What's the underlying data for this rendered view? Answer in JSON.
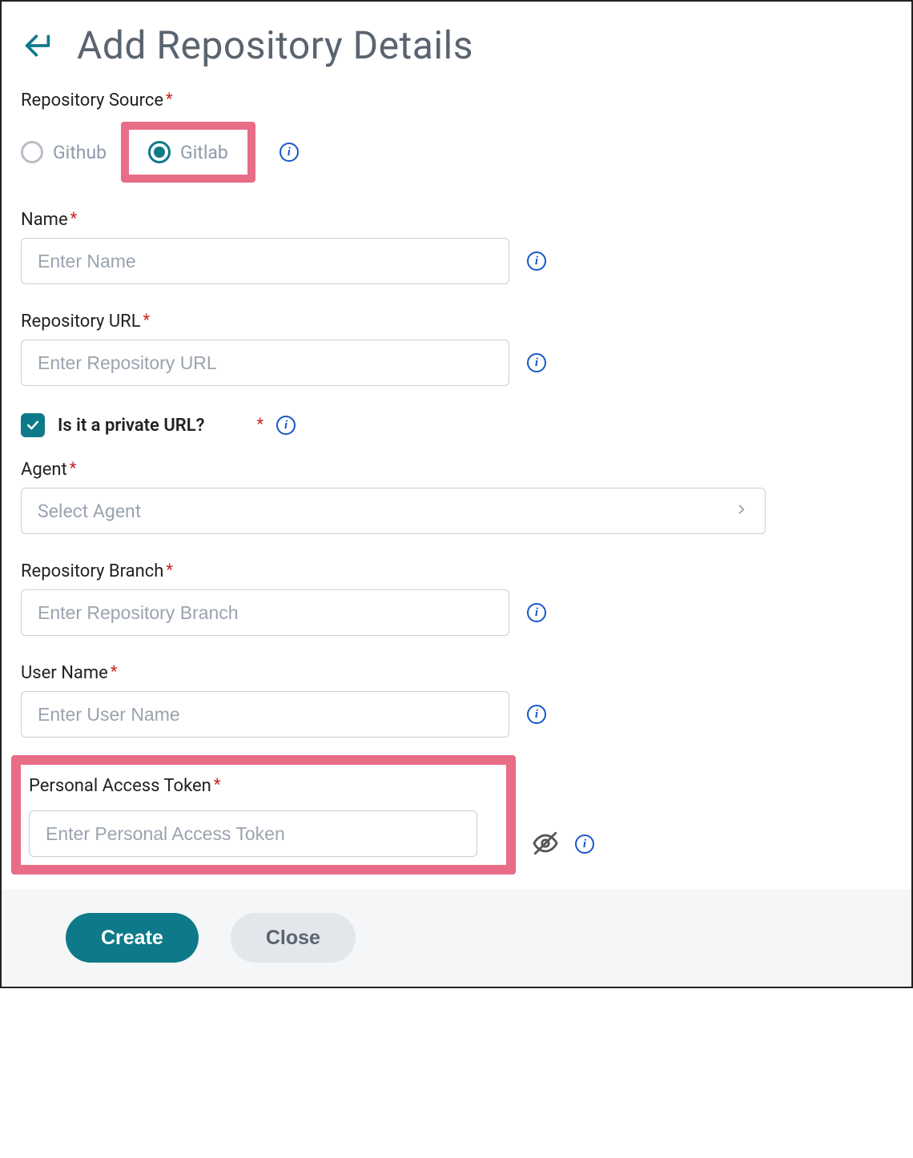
{
  "header": {
    "title": "Add Repository Details"
  },
  "fields": {
    "source": {
      "label": "Repository Source",
      "options": {
        "github": "Github",
        "gitlab": "Gitlab"
      },
      "selected": "gitlab"
    },
    "name": {
      "label": "Name",
      "placeholder": "Enter Name",
      "value": ""
    },
    "url": {
      "label": "Repository URL",
      "placeholder": "Enter Repository URL",
      "value": ""
    },
    "private": {
      "label": "Is it a private URL?",
      "checked": true
    },
    "agent": {
      "label": "Agent",
      "placeholder": "Select Agent",
      "value": ""
    },
    "branch": {
      "label": "Repository Branch",
      "placeholder": "Enter Repository Branch",
      "value": ""
    },
    "username": {
      "label": "User Name",
      "placeholder": "Enter User Name",
      "value": ""
    },
    "token": {
      "label": "Personal Access Token",
      "placeholder": "Enter Personal Access Token",
      "value": ""
    }
  },
  "buttons": {
    "create": "Create",
    "close": "Close"
  },
  "colors": {
    "accent": "#0e7a89",
    "highlight": "#e86d86",
    "required": "#c62828",
    "info": "#1856c9"
  }
}
